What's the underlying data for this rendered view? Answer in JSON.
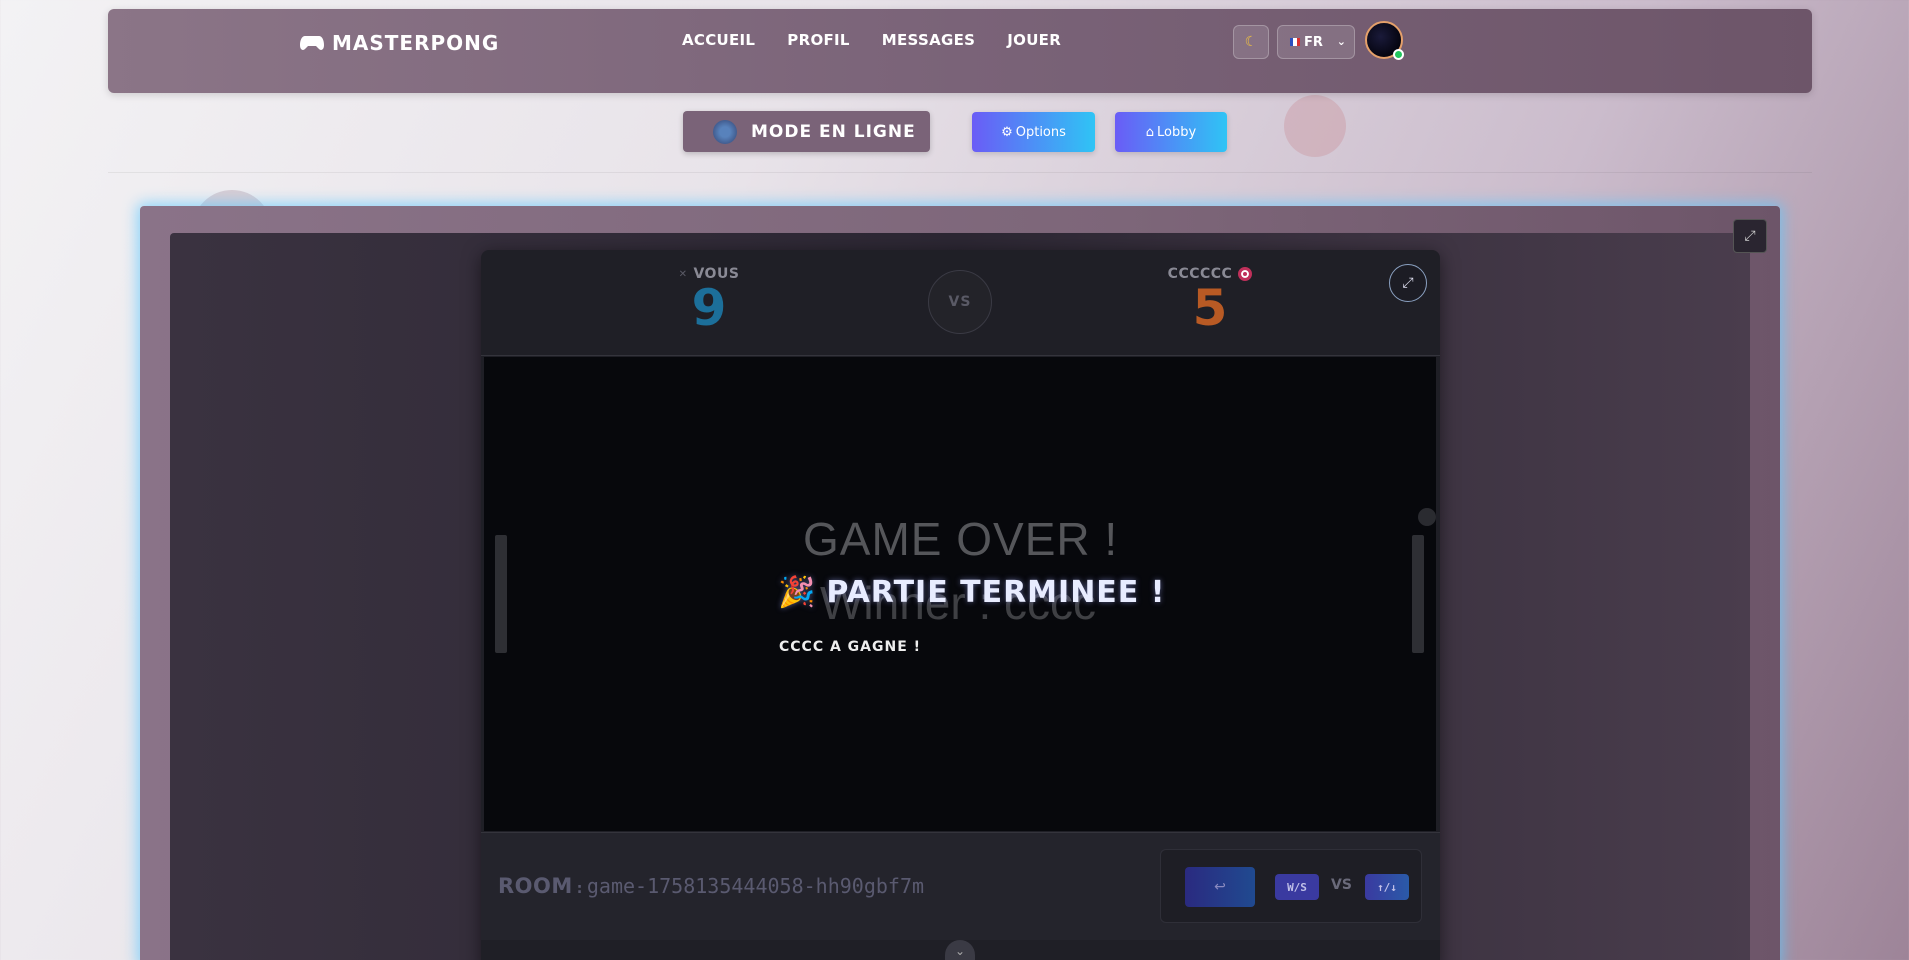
{
  "navbar": {
    "brand": "MASTERPONG",
    "links": [
      "ACCUEIL",
      "PROFIL",
      "MESSAGES",
      "JOUER"
    ],
    "theme_icon": "moon-icon",
    "language": "FR"
  },
  "mode_bar": {
    "mode_label": "MODE EN LIGNE",
    "options_label": "Options",
    "lobby_label": "Lobby"
  },
  "scoreboard": {
    "left_player": "VOUS",
    "left_score": "9",
    "vs": "VS",
    "right_player": "CCCCCC",
    "right_score": "5"
  },
  "canvas": {
    "game_over_text": "GAME OVER !",
    "winner_text": "Winner : cccc"
  },
  "overlay": {
    "title": "PARTIE TERMINEE !",
    "subtitle": "CCCC A GAGNE !"
  },
  "bottom": {
    "room_label": "ROOM",
    "room_value": "game-1758135444058-hh90gbf7m",
    "key_left": "W/S",
    "vs": "VS",
    "key_right": "↑/↓",
    "back_icon": "↩"
  },
  "colors": {
    "accent_blue": "#1c6f9a",
    "accent_orange": "#b85a24",
    "navbar": "#7a6378",
    "glow": "#5ac8ff"
  }
}
